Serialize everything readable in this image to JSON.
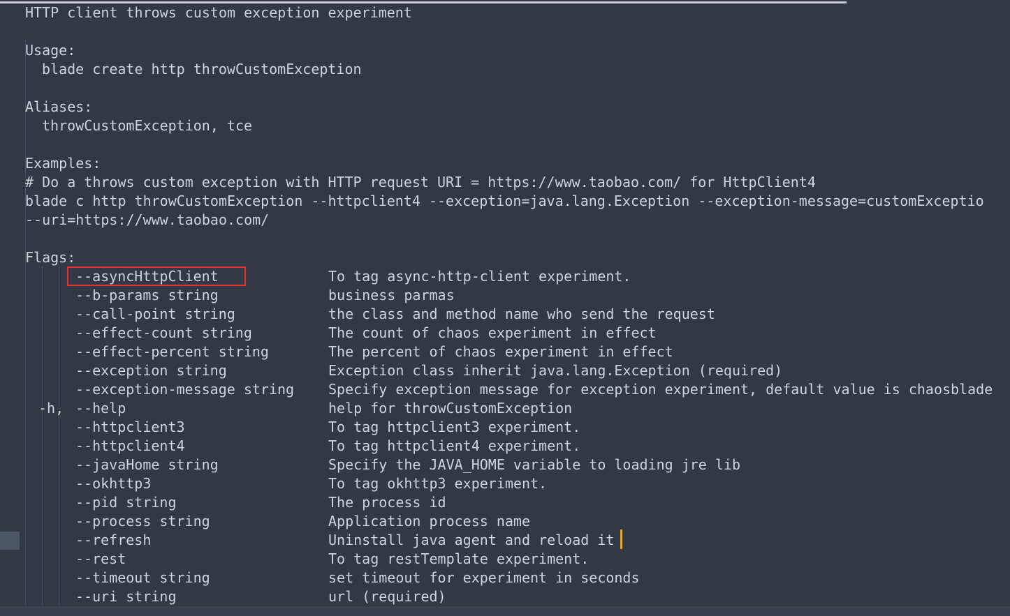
{
  "terminal": {
    "title_line": "HTTP client throws custom exception experiment",
    "sections": {
      "usage_label": "Usage:",
      "usage_command": "blade create http throwCustomException",
      "aliases_label": "Aliases:",
      "aliases_value": "throwCustomException, tce",
      "examples_label": "Examples:",
      "examples_comment": "# Do a throws custom exception with HTTP request URI = https://www.taobao.com/ for HttpClient4",
      "examples_command_line1": "blade c http throwCustomException --httpclient4 --exception=java.lang.Exception --exception-message=customExceptio",
      "examples_command_line2": "--uri=https://www.taobao.com/",
      "flags_label": "Flags:"
    },
    "flags": [
      {
        "short": "",
        "name": "--asyncHttpClient",
        "desc": "To tag async-http-client experiment.",
        "highlighted": true
      },
      {
        "short": "",
        "name": "--b-params string",
        "desc": "business parmas",
        "highlighted": false
      },
      {
        "short": "",
        "name": "--call-point string",
        "desc": "the class and method name who send the request",
        "highlighted": false
      },
      {
        "short": "",
        "name": "--effect-count string",
        "desc": "The count of chaos experiment in effect",
        "highlighted": false
      },
      {
        "short": "",
        "name": "--effect-percent string",
        "desc": "The percent of chaos experiment in effect",
        "highlighted": false
      },
      {
        "short": "",
        "name": "--exception string",
        "desc": "Exception class inherit java.lang.Exception (required)",
        "highlighted": false
      },
      {
        "short": "",
        "name": "--exception-message string",
        "desc": "Specify exception message for exception experiment, default value is chaosblade",
        "highlighted": false
      },
      {
        "short": "-h,",
        "name": "--help",
        "desc": "help for throwCustomException",
        "highlighted": false
      },
      {
        "short": "",
        "name": "--httpclient3",
        "desc": "To tag httpclient3 experiment.",
        "highlighted": false
      },
      {
        "short": "",
        "name": "--httpclient4",
        "desc": "To tag httpclient4 experiment.",
        "highlighted": false
      },
      {
        "short": "",
        "name": "--javaHome string",
        "desc": "Specify the JAVA_HOME variable to loading jre lib",
        "highlighted": false
      },
      {
        "short": "",
        "name": "--okhttp3",
        "desc": "To tag okhttp3 experiment.",
        "highlighted": false
      },
      {
        "short": "",
        "name": "--pid string",
        "desc": "The process id",
        "highlighted": false
      },
      {
        "short": "",
        "name": "--process string",
        "desc": "Application process name",
        "highlighted": false
      },
      {
        "short": "",
        "name": "--refresh",
        "desc": "Uninstall java agent and reload it",
        "highlighted": false
      },
      {
        "short": "",
        "name": "--rest",
        "desc": "To tag restTemplate experiment.",
        "highlighted": false
      },
      {
        "short": "",
        "name": "--timeout string",
        "desc": "set timeout for experiment in seconds",
        "highlighted": false
      },
      {
        "short": "",
        "name": "--uri string",
        "desc": "url (required)",
        "highlighted": false
      }
    ],
    "colors": {
      "background": "#323844",
      "foreground": "#cdd3de",
      "highlight_border": "#e8322e",
      "caret": "#e8a33d",
      "gutter_marker": "#4c5664",
      "indent_guide": "#5a6273",
      "scrollbar_thumb": "#c9ccd1",
      "scrollbar_track": "#3a4150"
    }
  }
}
